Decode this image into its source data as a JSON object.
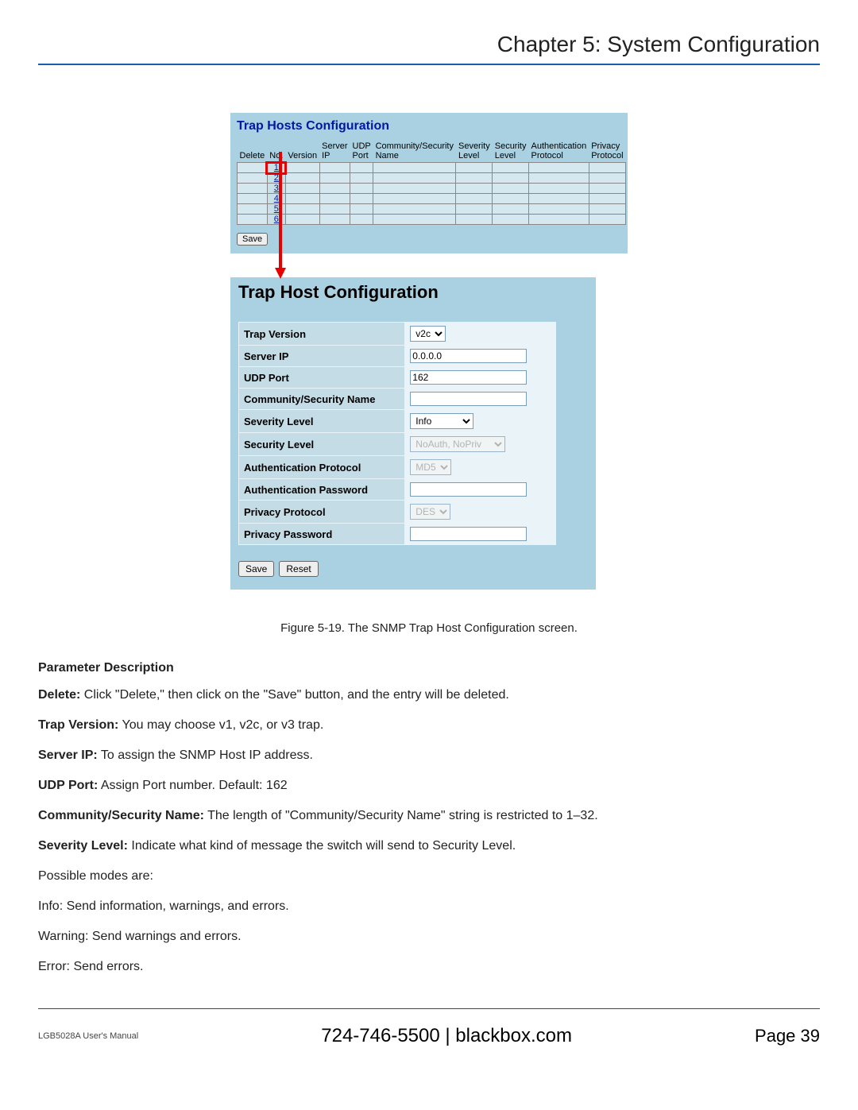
{
  "header": {
    "chapter": "Chapter 5: System Configuration"
  },
  "panel1": {
    "title": "Trap Hosts Configuration",
    "headers": {
      "delete": "Delete",
      "no": "No.",
      "version": "Version",
      "server_ip": "Server IP",
      "udp_port": "UDP Port",
      "community": "Community/Security Name",
      "severity": "Severity Level",
      "security": "Security Level",
      "auth": "Authentication Protocol",
      "privacy": "Privacy Protocol"
    },
    "rows": [
      "1",
      "2",
      "3",
      "4",
      "5",
      "6"
    ],
    "save_label": "Save"
  },
  "panel2": {
    "title": "Trap Host Configuration",
    "fields": {
      "trap_version": {
        "label": "Trap Version",
        "value": "v2c"
      },
      "server_ip": {
        "label": "Server IP",
        "value": "0.0.0.0"
      },
      "udp_port": {
        "label": "UDP Port",
        "value": "162"
      },
      "community": {
        "label": "Community/Security Name",
        "value": ""
      },
      "severity": {
        "label": "Severity Level",
        "value": "Info"
      },
      "security": {
        "label": "Security Level",
        "value": "NoAuth, NoPriv"
      },
      "auth_proto": {
        "label": "Authentication Protocol",
        "value": "MD5"
      },
      "auth_pass": {
        "label": "Authentication Password",
        "value": ""
      },
      "priv_proto": {
        "label": "Privacy Protocol",
        "value": "DES"
      },
      "priv_pass": {
        "label": "Privacy Password",
        "value": ""
      }
    },
    "save_label": "Save",
    "reset_label": "Reset"
  },
  "figure_caption": "Figure 5-19. The SNMP Trap Host Configuration screen.",
  "desc": {
    "heading": "Parameter Description",
    "delete_t": "Delete:",
    "delete_d": " Click \"Delete,\" then click on the \"Save\" button, and the entry will be deleted.",
    "trapv_t": "Trap Version:",
    "trapv_d": " You may choose v1, v2c, or v3 trap.",
    "sip_t": "Server IP:",
    "sip_d": " To assign the SNMP Host IP address.",
    "udp_t": "UDP Port:",
    "udp_d": " Assign Port number. Default: 162",
    "comm_t": "Community/Security Name:",
    "comm_d": " The length of \"Community/Security Name\" string is restricted to 1–32.",
    "sev_t": "Severity Level:",
    "sev_d": " Indicate what kind of message the switch will send to Security Level.",
    "modes": "Possible modes are:",
    "info": "Info: Send information, warnings, and errors.",
    "warn": "Warning: Send warnings and errors.",
    "err": "Error: Send errors."
  },
  "footer": {
    "manual": "LGB5028A User's Manual",
    "contact": "724-746-5500   |   blackbox.com",
    "page": "Page 39"
  }
}
